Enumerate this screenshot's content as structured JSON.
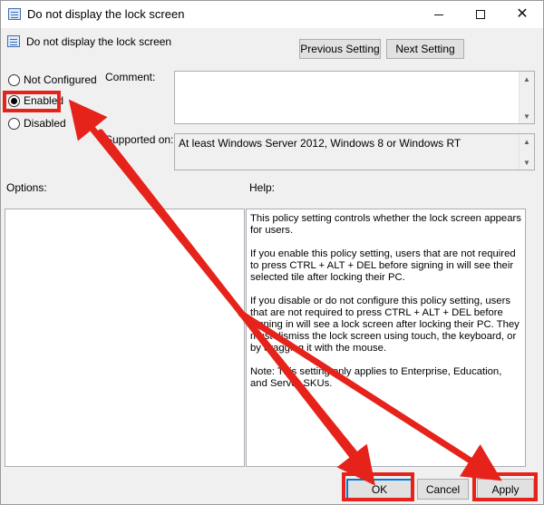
{
  "window": {
    "title": "Do not display the lock screen",
    "icon": "policy-icon",
    "controls": [
      "minimize-icon",
      "maximize-icon",
      "close-icon"
    ]
  },
  "header": {
    "policy_title": "Do not display the lock screen",
    "previous_label": "Previous Setting",
    "next_label": "Next Setting"
  },
  "state": {
    "options": [
      {
        "label": "Not Configured",
        "checked": false
      },
      {
        "label": "Enabled",
        "checked": true
      },
      {
        "label": "Disabled",
        "checked": false
      }
    ]
  },
  "labels": {
    "comment": "Comment:",
    "supported": "Supported on:",
    "options": "Options:",
    "help": "Help:"
  },
  "comment_value": "",
  "supported_value": "At least Windows Server 2012, Windows 8 or Windows RT",
  "help_text": {
    "p1": "This policy setting controls whether the lock screen appears for users.",
    "p2": "If you enable this policy setting, users that are not required to press CTRL + ALT + DEL before signing in will see their selected tile after locking their PC.",
    "p3": "If you disable or do not configure this policy setting, users that are not required to press CTRL + ALT + DEL before signing in will see a lock screen after locking their PC. They must dismiss the lock screen using touch, the keyboard, or by dragging it with the mouse.",
    "p4": "Note: This setting only applies to Enterprise, Education, and Server SKUs."
  },
  "footer": {
    "ok_label": "OK",
    "cancel_label": "Cancel",
    "apply_label": "Apply"
  },
  "colors": {
    "annotation": "#e6231b",
    "focus": "#0078d7"
  }
}
